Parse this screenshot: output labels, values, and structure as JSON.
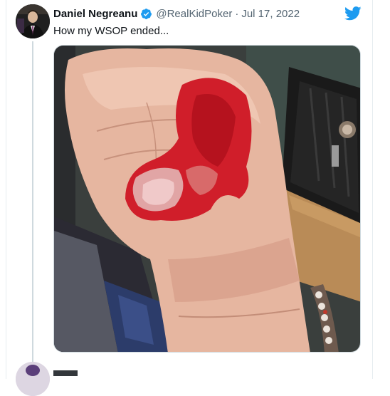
{
  "tweet": {
    "display_name": "Daniel Negreanu",
    "handle": "@RealKidPoker",
    "separator": "·",
    "date": "Jul 17, 2022",
    "text": "How my WSOP ended..."
  },
  "icons": {
    "verified": "verified-badge-icon",
    "brand": "twitter-bird-icon"
  },
  "colors": {
    "twitter_blue": "#1d9bf0",
    "text_primary": "#0f1419",
    "text_secondary": "#536471",
    "border": "#cfd9de"
  }
}
